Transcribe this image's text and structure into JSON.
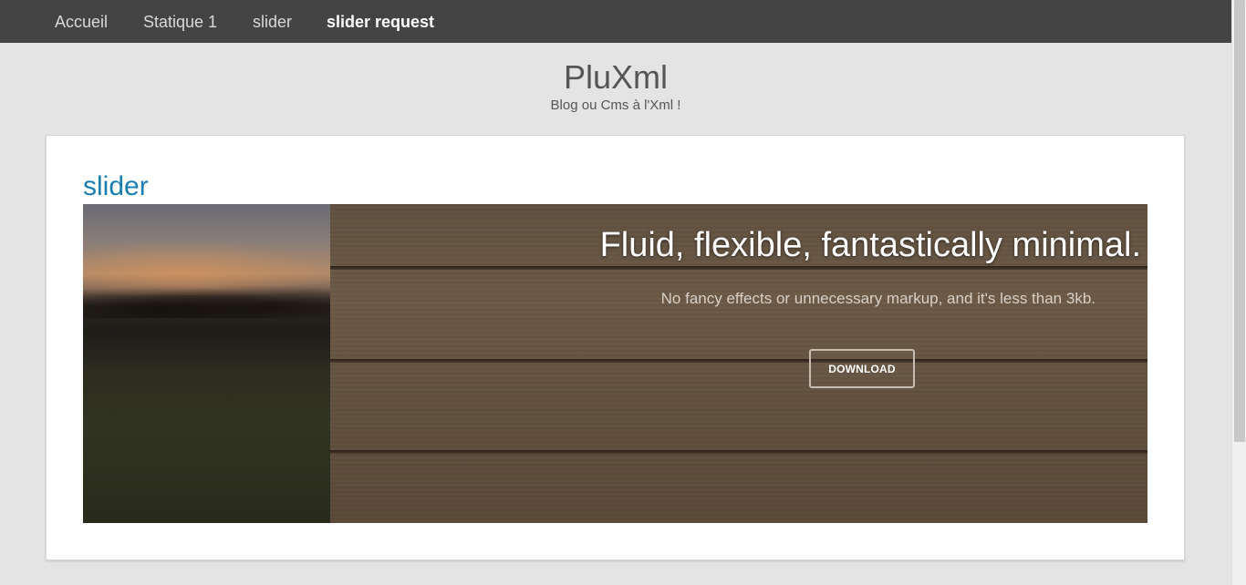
{
  "nav": {
    "items": [
      {
        "label": "Accueil"
      },
      {
        "label": "Statique 1"
      },
      {
        "label": "slider"
      },
      {
        "label": "slider request"
      }
    ],
    "active_index": 3
  },
  "site": {
    "title": "PluXml",
    "description": "Blog ou Cms à l'Xml !"
  },
  "article": {
    "heading": "slider"
  },
  "slider": {
    "title": "Fluid, flexible, fantastically minimal.",
    "subtitle": "No fancy effects or unnecessary markup, and it's less than 3kb.",
    "button_label": "DOWNLOAD"
  },
  "colors": {
    "topbar": "#444444",
    "background": "#e4e4e4",
    "heading_link": "#1a7fb0"
  }
}
